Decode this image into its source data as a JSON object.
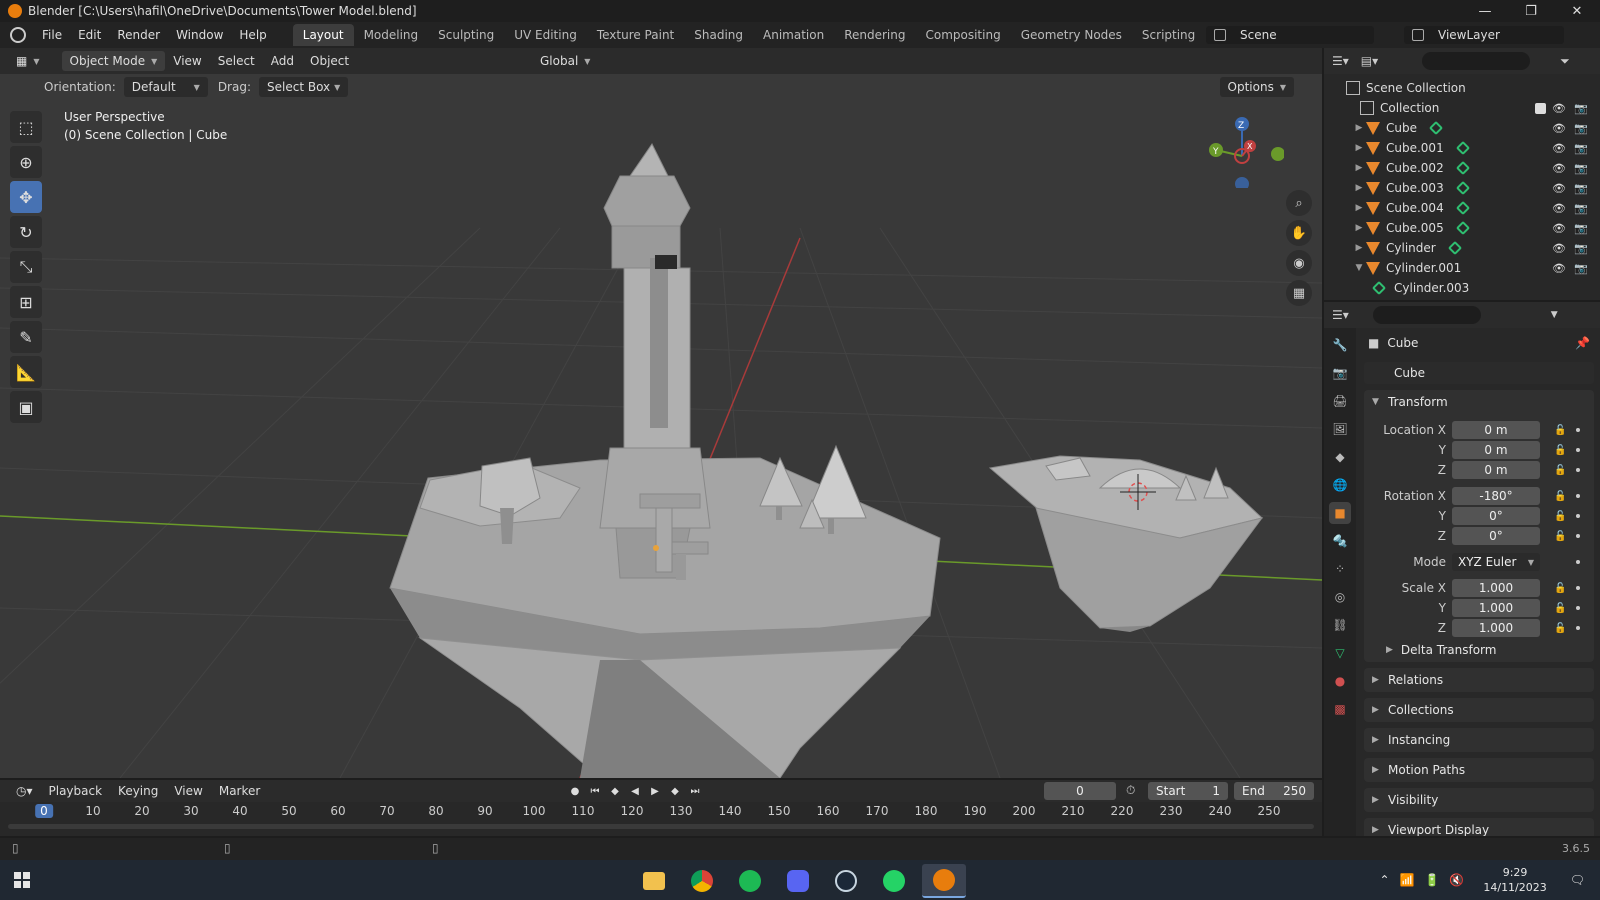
{
  "window": {
    "title": "Blender [C:\\Users\\hafil\\OneDrive\\Documents\\Tower Model.blend]",
    "minimize": "—",
    "maximize": "❐",
    "close": "✕"
  },
  "menu": {
    "items": [
      "File",
      "Edit",
      "Render",
      "Window",
      "Help"
    ]
  },
  "workspaces": {
    "tabs": [
      "Layout",
      "Modeling",
      "Sculpting",
      "UV Editing",
      "Texture Paint",
      "Shading",
      "Animation",
      "Rendering",
      "Compositing",
      "Geometry Nodes",
      "Scripting"
    ],
    "active": "Layout",
    "plus": "+"
  },
  "scene": {
    "name": "Scene",
    "view_layer": "ViewLayer"
  },
  "viewport": {
    "mode": "Object Mode",
    "menus": [
      "View",
      "Select",
      "Add",
      "Object"
    ],
    "transform_orientation": "Global",
    "orientation_label": "Orientation:",
    "orientation_value": "Default",
    "drag_label": "Drag:",
    "drag_value": "Select Box",
    "options": "Options",
    "info_line1": "User Perspective",
    "info_line2": "(0) Scene Collection | Cube",
    "gizmo": {
      "x": "X",
      "y": "Y",
      "z": "Z"
    },
    "colors": {
      "bg": "#393939",
      "grid": "#444444",
      "x_axis": "#a83a3a",
      "y_axis": "#6a9a2a",
      "mesh": "#9a9a9a"
    }
  },
  "toolbar": {
    "tools": [
      "select-box-icon",
      "cursor-icon",
      "move-icon",
      "rotate-icon",
      "scale-icon",
      "transform-icon",
      "annotate-icon",
      "measure-icon",
      "add-cube-icon"
    ],
    "active": "move-icon"
  },
  "outliner": {
    "root": "Scene Collection",
    "collection": "Collection",
    "objects": [
      "Cube",
      "Cube.001",
      "Cube.002",
      "Cube.003",
      "Cube.004",
      "Cube.005",
      "Cylinder",
      "Cylinder.001"
    ],
    "child": "Cylinder.003"
  },
  "properties": {
    "object_name": "Cube",
    "data_name": "Cube",
    "transform": {
      "title": "Transform",
      "location_label": "Location X",
      "location": [
        "0 m",
        "0 m",
        "0 m"
      ],
      "rotation_label": "Rotation X",
      "rotation": [
        "-180°",
        "0°",
        "0°"
      ],
      "mode_label": "Mode",
      "mode": "XYZ Euler",
      "scale_label": "Scale X",
      "scale": [
        "1.000",
        "1.000",
        "1.000"
      ],
      "y": "Y",
      "z": "Z"
    },
    "delta": "Delta Transform",
    "panels": [
      "Relations",
      "Collections",
      "Instancing",
      "Motion Paths",
      "Visibility",
      "Viewport Display"
    ]
  },
  "timeline": {
    "menus": [
      "Playback",
      "Keying",
      "View",
      "Marker"
    ],
    "current_frame": "0",
    "start_label": "Start",
    "start": "1",
    "end_label": "End",
    "end": "250",
    "ticks": [
      "0",
      "10",
      "20",
      "30",
      "40",
      "50",
      "60",
      "70",
      "80",
      "90",
      "100",
      "110",
      "120",
      "130",
      "140",
      "150",
      "160",
      "170",
      "180",
      "190",
      "200",
      "210",
      "220",
      "230",
      "240",
      "250"
    ]
  },
  "status": {
    "version": "3.6.5"
  },
  "taskbar": {
    "apps": [
      "file-explorer-icon",
      "chrome-icon",
      "spotify-icon",
      "discord-icon",
      "steam-icon",
      "whatsapp-icon",
      "blender-icon"
    ],
    "time": "9:29",
    "date": "14/11/2023"
  }
}
